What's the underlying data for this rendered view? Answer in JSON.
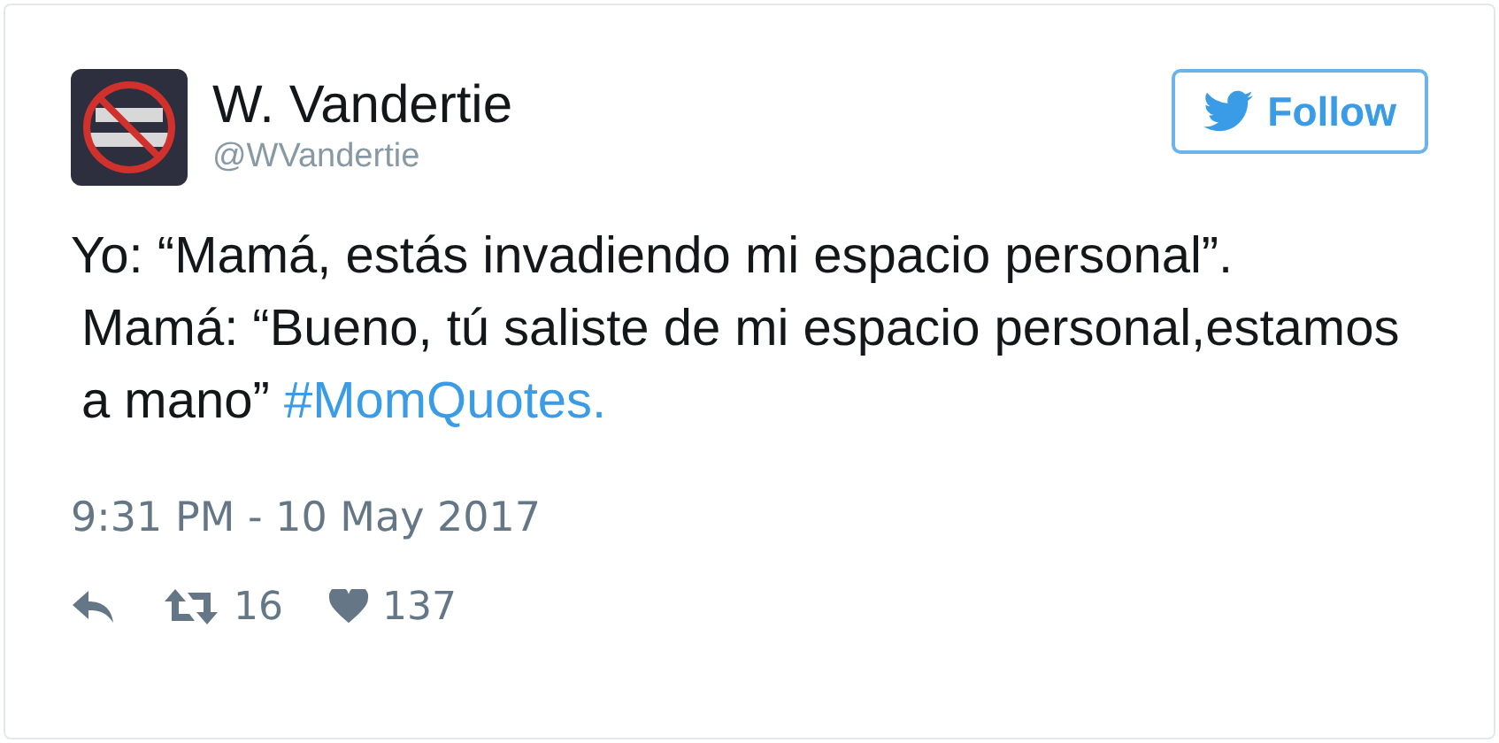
{
  "author": {
    "name": "W. Vandertie",
    "handle": "@WVandertie"
  },
  "follow_button": {
    "label": "Follow"
  },
  "tweet": {
    "lines": [
      {
        "text": "Yo: “Mamá, estás invadiendo mi espacio personal”."
      },
      {
        "text": "Mamá: “Bueno, tú saliste de mi espacio personal,estamos"
      },
      {
        "text": "a mano”",
        "hashtag": "#MomQuotes."
      }
    ]
  },
  "timestamp": "9:31 PM - 10 May 2017",
  "actions": {
    "retweets": "16",
    "likes": "137"
  }
}
